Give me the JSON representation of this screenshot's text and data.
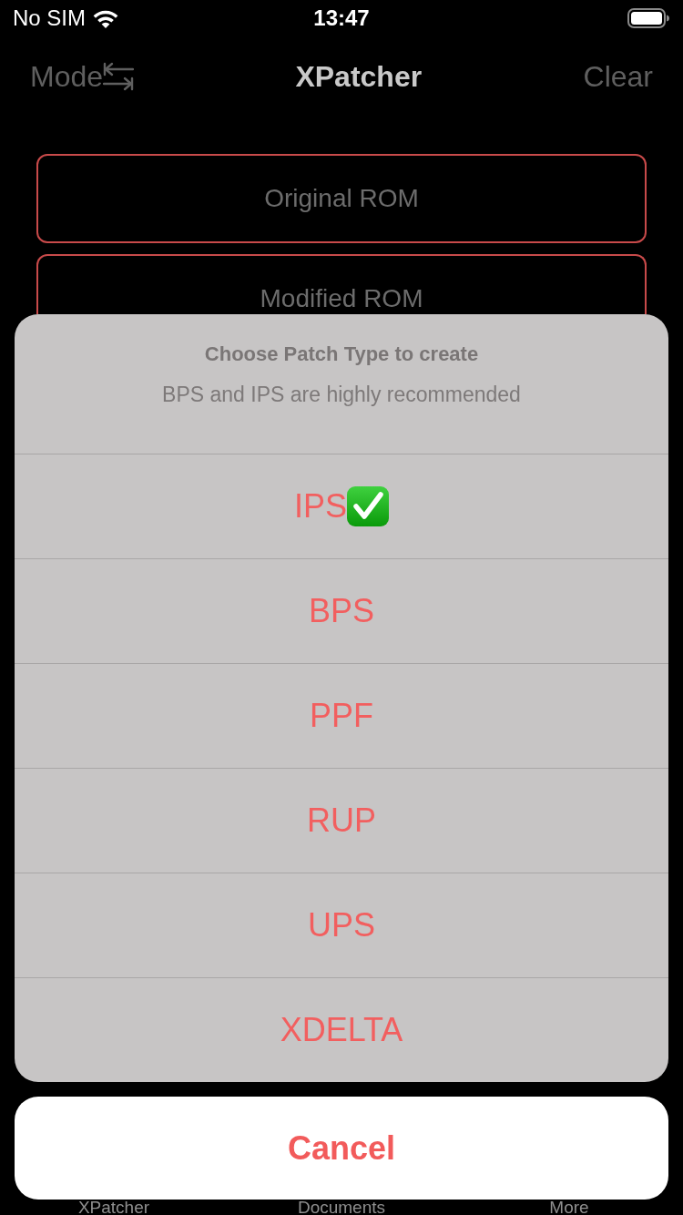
{
  "status_bar": {
    "carrier": "No SIM",
    "time": "13:47"
  },
  "nav_bar": {
    "left_button": "Mode",
    "title": "XPatcher",
    "right_button": "Clear"
  },
  "file_buttons": [
    "Original ROM",
    "Modified ROM"
  ],
  "action_sheet": {
    "title": "Choose Patch Type to create",
    "message": "BPS and IPS are highly recommended",
    "options": [
      {
        "label": "IPS",
        "selected": true
      },
      {
        "label": "BPS",
        "selected": false
      },
      {
        "label": "PPF",
        "selected": false
      },
      {
        "label": "RUP",
        "selected": false
      },
      {
        "label": "UPS",
        "selected": false
      },
      {
        "label": "XDELTA",
        "selected": false
      }
    ],
    "cancel": "Cancel"
  },
  "tab_bar": [
    {
      "label": "XPatcher"
    },
    {
      "label": "Documents"
    },
    {
      "label": "More"
    }
  ]
}
